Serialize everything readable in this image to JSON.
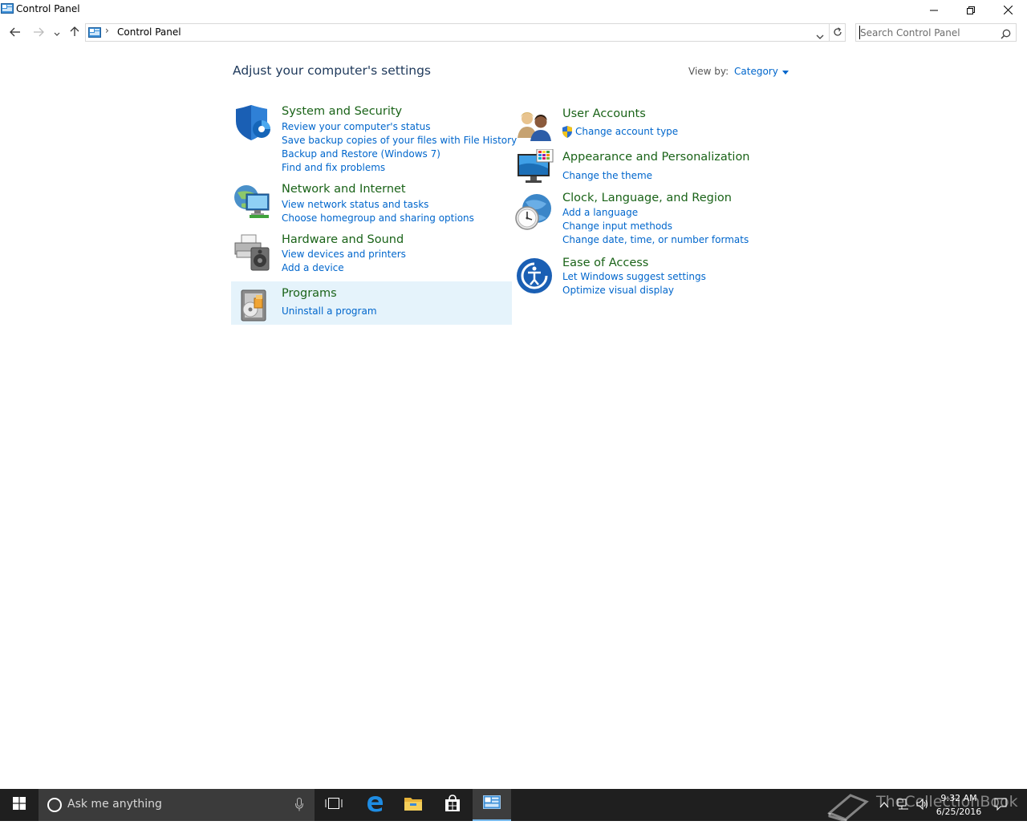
{
  "window": {
    "title": "Control Panel"
  },
  "address": {
    "location": "Control Panel",
    "separator": "›"
  },
  "search": {
    "placeholder": "Search Control Panel"
  },
  "content": {
    "heading": "Adjust your computer's settings",
    "view_by_label": "View by:",
    "view_by_value": "Category",
    "categories": [
      {
        "title": "System and Security",
        "icon": "shield-icon",
        "links": [
          "Review your computer's status",
          "Save backup copies of your files with File History",
          "Backup and Restore (Windows 7)",
          "Find and fix problems"
        ]
      },
      {
        "title": "Network and Internet",
        "icon": "network-globe-icon",
        "links": [
          "View network status and tasks",
          "Choose homegroup and sharing options"
        ]
      },
      {
        "title": "Hardware and Sound",
        "icon": "printer-speaker-icon",
        "links": [
          "View devices and printers",
          "Add a device"
        ]
      },
      {
        "title": "Programs",
        "icon": "programs-disc-icon",
        "links": [
          "Uninstall a program"
        ]
      },
      {
        "title": "User Accounts",
        "icon": "users-icon",
        "links": [
          "Change account type"
        ]
      },
      {
        "title": "Appearance and Personalization",
        "icon": "monitor-palette-icon",
        "links": [
          "Change the theme"
        ]
      },
      {
        "title": "Clock, Language, and Region",
        "icon": "clock-globe-icon",
        "links": [
          "Add a language",
          "Change input methods",
          "Change date, time, or number formats"
        ]
      },
      {
        "title": "Ease of Access",
        "icon": "ease-of-access-icon",
        "links": [
          "Let Windows suggest settings",
          "Optimize visual display"
        ]
      }
    ]
  },
  "taskbar": {
    "search_text": "Ask me anything",
    "clock_time": "9:32 AM",
    "clock_date": "6/25/2016",
    "watermark": "TheCollectionBook"
  },
  "colors": {
    "category_title": "#1a6318",
    "link": "#0066cc",
    "heading": "#1e395b",
    "hover_bg": "#e5f3fb",
    "taskbar": "#1f1f1f"
  }
}
